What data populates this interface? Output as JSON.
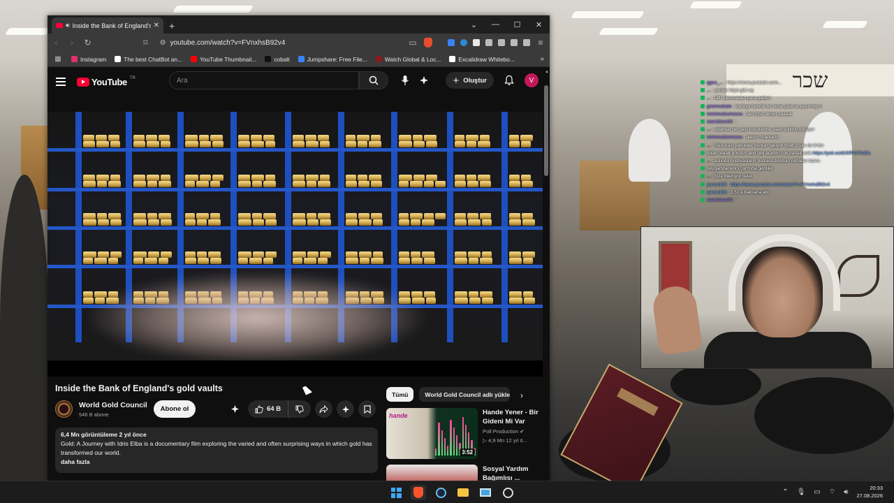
{
  "browser": {
    "tab_title": "Inside the Bank of England's gold vaults - YouTube",
    "new_tab_symbol": "+",
    "url": "youtube.com/watch?v=FVnxhsB92v4",
    "bookmarks": [
      {
        "label": "Instagram",
        "color": "#e1306c"
      },
      {
        "label": "The best ChatBot an...",
        "color": "#ffffff"
      },
      {
        "label": "YouTube Thumbnail...",
        "color": "#ff0000"
      },
      {
        "label": "cobalt",
        "color": "#111111"
      },
      {
        "label": "Jumpshare: Free File...",
        "color": "#3b82f6"
      },
      {
        "label": "Watch Global & Loc...",
        "color": "#8b1b1b"
      },
      {
        "label": "Excalidraw Whitebo...",
        "color": "#ffffff"
      }
    ]
  },
  "youtube": {
    "logo_text": "YouTube",
    "region": "TR",
    "search_placeholder": "Ara",
    "create_label": "Oluştur",
    "avatar_letter": "V",
    "video": {
      "title": "Inside the Bank of England's gold vaults",
      "channel": "World Gold Council",
      "subscribers": "546 B abone",
      "subscribe_label": "Abone ol",
      "likes": "64 B",
      "meta": "6,4 Mn görüntüleme  2 yıl önce",
      "description": "Gold: A Journey with Idris Elba is a documentary film exploring the varied and often surprising ways in which gold has transformed our world.",
      "more_label": "daha fazla"
    },
    "chips": [
      "Tümü",
      "World Gold Council adlı yükle"
    ],
    "recommendations": [
      {
        "title": "Hande Yener - Bir Gideni Mi Var",
        "channel": "Poll Production",
        "meta": "4,9 Mn  12 yıl ö...",
        "duration": "3:52",
        "thumb_text": "hande"
      },
      {
        "title": "Sosyal Yardım Bağımlısı ...",
        "channel": "",
        "meta": "",
        "duration": "",
        "thumb_text": ""
      }
    ]
  },
  "chat": [
    {
      "user": "ggeo_...",
      "text": "https://www.youtube.com...",
      "color": "purple"
    },
    {
      "user": "...",
      "text": "şirinler köyü gibi aq",
      "color": "purple"
    },
    {
      "user": "...",
      "text": "laflı çalısmadan para geliyor",
      "color": "purple"
    },
    {
      "user": "greensalads",
      "text": "kadrıya tanıdık bir sima çıkarsa şaşırmayın",
      "color": "purple"
    },
    {
      "user": "memevakumcusu",
      "text": "tam özet okuyo çaaqal",
      "color": "purple"
    },
    {
      "user": "starcitizen33",
      "text": ":",
      "color": "purple"
    },
    {
      "user": "...",
      "text": "adamlar her şeyi kendilerine vaad edilmiş görüyor",
      "color": "purple"
    },
    {
      "user": "memevakumcusu",
      "text": "aleizm markadır",
      "color": "purple"
    },
    {
      "user": "...",
      "text": "Reis bazı yahudiler bunları takıyor fiyatı 2 site de 8 bin",
      "color": "red"
    },
    {
      "user": "",
      "text": "dolar olarak gördüm abd gibi arattım çok pahalı amk",
      "link": "https://yoti.sc/dUKPA37bJDc",
      "color": "purple"
    },
    {
      "user": "...",
      "text": "aslında hristiyanların bunlara düşman olmaları lazım.",
      "color": "red"
    },
    {
      "user": "",
      "text": "peygamberlerini çarmıha gerdiler",
      "color": "purple"
    },
    {
      "user": "...",
      "text": "bize bileniyor oeler",
      "color": "red"
    },
    {
      "user": "yunox135",
      "text": "",
      "link": "https://www.youtube.com/watch?v=FVnxhsB92v4",
      "color": "cyan"
    },
    {
      "user": "yunox135",
      "text": "1.51 e baksana abi",
      "color": "cyan"
    },
    {
      "user": "starcitizen33",
      "text": ":",
      "color": "purple"
    }
  ],
  "taskbar": {
    "time": "20:33",
    "date": "27.08.2026"
  }
}
